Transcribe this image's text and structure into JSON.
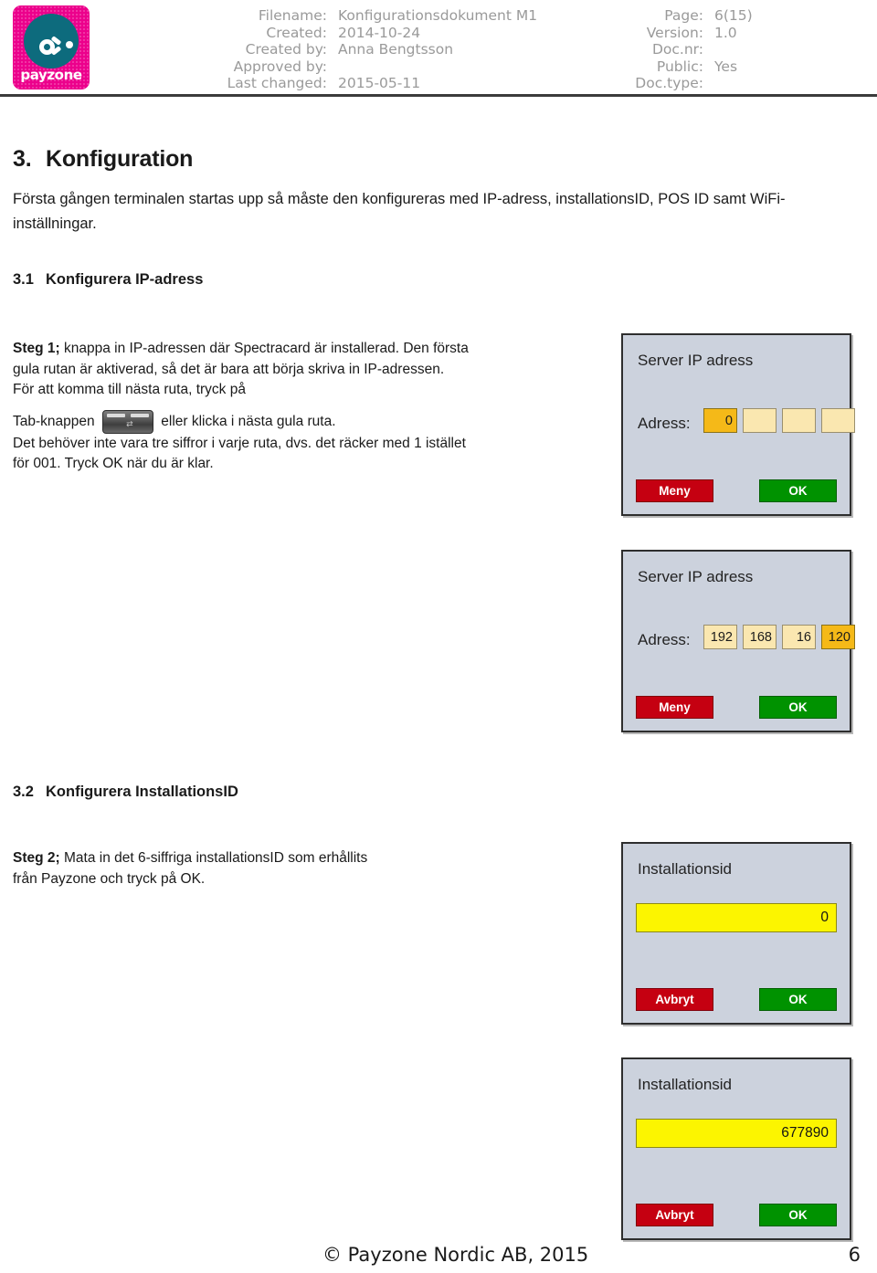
{
  "header": {
    "logo": {
      "wordmark": "payzone"
    },
    "left_fields": [
      {
        "label": "Filename:",
        "value": "Konfigurationsdokument M1"
      },
      {
        "label": "Created:",
        "value": "2014-10-24"
      },
      {
        "label": "Created by:",
        "value": "Anna Bengtsson"
      },
      {
        "label": "Approved by:",
        "value": ""
      },
      {
        "label": "Last changed:",
        "value": "2015-05-11"
      }
    ],
    "right_fields": [
      {
        "label": "Page:",
        "value": "6(15)"
      },
      {
        "label": "Version:",
        "value": "1.0"
      },
      {
        "label": "Doc.nr:",
        "value": ""
      },
      {
        "label": "Public:",
        "value": "Yes"
      },
      {
        "label": "Doc.type:",
        "value": ""
      }
    ]
  },
  "content": {
    "section3": {
      "number": "3.",
      "title": "Konfiguration",
      "intro": "Första gången terminalen startas upp så måste den konfigureras med IP-adress, installationsID, POS ID samt WiFi-inställningar."
    },
    "section31": {
      "number": "3.1",
      "title": "Konfigurera IP-adress",
      "step_label": "Steg 1;",
      "line1": " knappa in IP-adressen där Spectracard är installerad. Den första",
      "line2": "gula rutan är aktiverad, så det är bara att börja skriva in IP-adressen.",
      "line3": "För att komma till nästa ruta, tryck på",
      "line4_before": "Tab-knappen",
      "line4_after": "eller klicka i nästa gula ruta.",
      "line5": "Det behöver inte vara tre siffror i varje ruta, dvs. det räcker med 1 istället",
      "line6": "för 001. Tryck OK när du är klar."
    },
    "section32": {
      "number": "3.2",
      "title": "Konfigurera InstallationsID",
      "step_label": "Steg 2;",
      "line1": " Mata in det 6-siffriga installationsID som erhållits",
      "line2": "från Payzone och tryck på OK."
    }
  },
  "screens": {
    "ip_empty": {
      "title": "Server IP adress",
      "field_label": "Adress:",
      "octets": [
        "0",
        "",
        "",
        ""
      ],
      "active_octet": 0,
      "button_left": "Meny",
      "button_right": "OK"
    },
    "ip_filled": {
      "title": "Server IP adress",
      "field_label": "Adress:",
      "octets": [
        "192",
        "168",
        "16",
        "120"
      ],
      "active_octet": 3,
      "button_left": "Meny",
      "button_right": "OK"
    },
    "inst_empty": {
      "title": "Installationsid",
      "value": "0",
      "button_left": "Avbryt",
      "button_right": "OK"
    },
    "inst_filled": {
      "title": "Installationsid",
      "value": "677890",
      "button_left": "Avbryt",
      "button_right": "OK"
    }
  },
  "footer": {
    "copyright": "© Payzone Nordic AB, 2015",
    "page_number": "6"
  },
  "colors": {
    "brand_pink": "#ec008c",
    "brand_teal": "#0d6b7d",
    "screen_bg": "#ccd2dd",
    "field_idle": "#fae7b0",
    "field_active": "#f5b918",
    "field_yellow": "#fcf500",
    "button_red": "#c50011",
    "button_green": "#009200"
  }
}
